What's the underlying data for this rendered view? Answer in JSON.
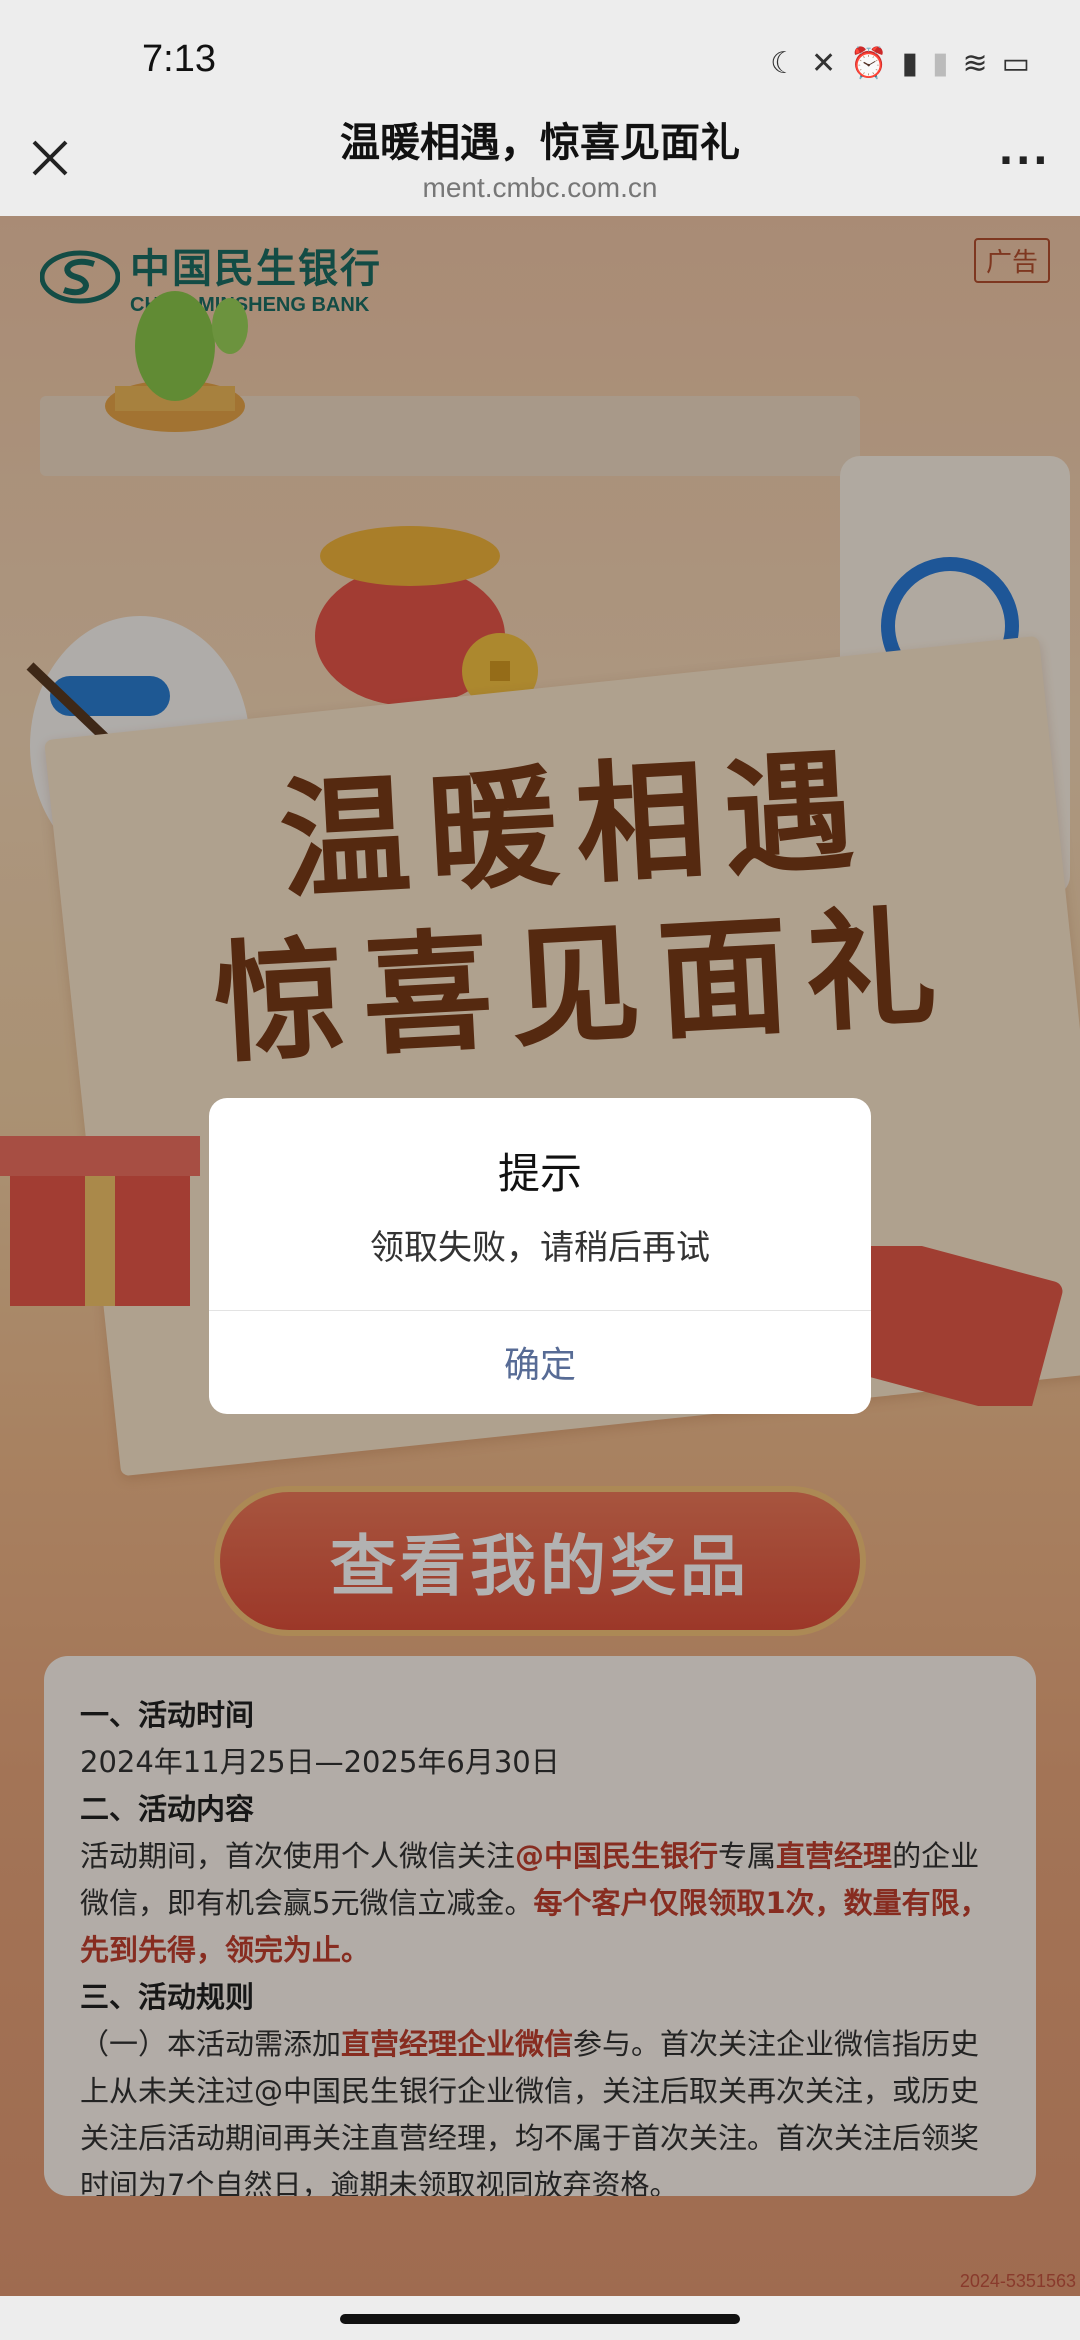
{
  "status_bar": {
    "time": "7:13"
  },
  "nav": {
    "title": "温暖相遇，惊喜见面礼",
    "url": "ment.cmbc.com.cn",
    "more_label": "···"
  },
  "banner": {
    "bank_name_cn": "中国民生银行",
    "bank_name_en": "CHINA MINSHENG BANK",
    "ad_label": "广告",
    "headline_line1": "温暖相遇",
    "headline_line2": "惊喜见面礼",
    "prize_button_label": "查看我的奖品"
  },
  "rules": {
    "section1_title": "一、活动时间",
    "section1_text": "2024年11月25日—2025年6月30日",
    "section2_title": "二、活动内容",
    "section2_p1": "活动期间，首次使用个人微信关注",
    "section2_hl1": "@中国民生银行",
    "section2_p2": "专属",
    "section2_hl2": "直营经理",
    "section2_p3": "的企业微信，即有机会赢5元微信立减金。",
    "section2_hl3": "每个客户仅限领取1次，数量有限，先到先得，领完为止。",
    "section3_title": "三、活动规则",
    "section3_p1": "（一）本活动需添加",
    "section3_hl1": "直营经理企业微信",
    "section3_p2": "参与。首次关注企业微信指历史上从未关注过@中国民生银行企业微信，关注后取关再次关注，或历史关注后活动期间再关注直营经理，均不属于首次关注。首次关注后领奖时间为7个自然日，逾期未领取视同放弃资格。"
  },
  "doc_code": "2024-5351563",
  "dialog": {
    "title": "提示",
    "message": "领取失败，请稍后再试",
    "confirm_label": "确定"
  },
  "colors": {
    "accent_link": "#576b95",
    "brand_green": "#1c6d64",
    "highlight_red": "#c2402f",
    "prize_button": "#e0503b"
  }
}
